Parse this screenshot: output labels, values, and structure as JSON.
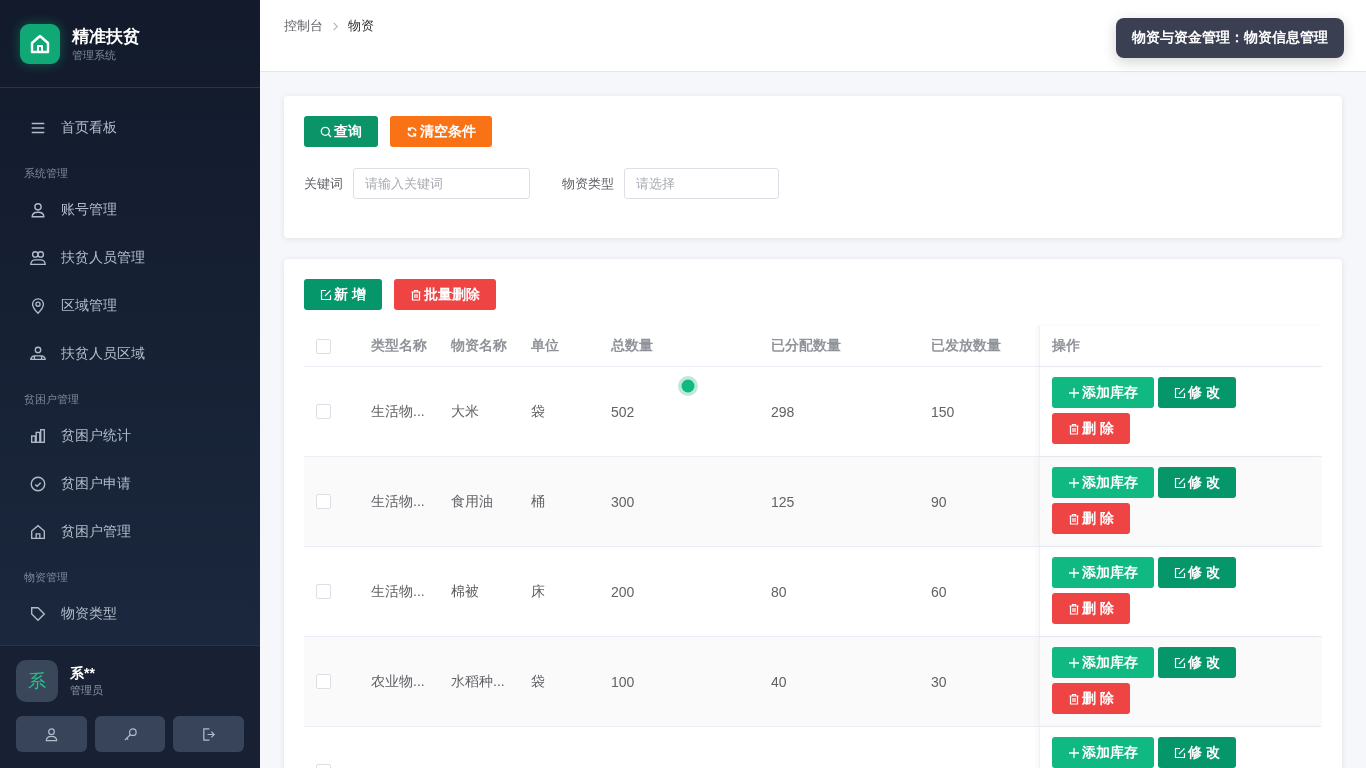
{
  "sidebar": {
    "brand": {
      "title": "精准扶贫",
      "subtitle": "管理系统"
    },
    "groups": [
      {
        "items": [
          {
            "label": "首页看板",
            "selected": false
          }
        ]
      },
      {
        "title": "系统管理",
        "items": [
          {
            "label": "账号管理",
            "selected": false
          },
          {
            "label": "扶贫人员管理",
            "selected": false
          },
          {
            "label": "区域管理",
            "selected": false
          },
          {
            "label": "扶贫人员区域",
            "selected": false
          }
        ]
      },
      {
        "title": "贫困户管理",
        "items": [
          {
            "label": "贫困户统计",
            "selected": false
          },
          {
            "label": "贫困户申请",
            "selected": false
          },
          {
            "label": "贫困户管理",
            "selected": false
          }
        ]
      },
      {
        "title": "物资管理",
        "items": [
          {
            "label": "物资类型",
            "selected": false
          }
        ]
      }
    ],
    "user": {
      "avatar": "系",
      "name": "系**",
      "role": "管理员"
    }
  },
  "breadcrumb": [
    "控制台",
    "物资"
  ],
  "toast": "物资与资金管理：物资信息管理",
  "search": {
    "buttons": [
      "查询",
      "清空条件"
    ],
    "fields": [
      {
        "label": "关键词",
        "placeholder": "请输入关键词"
      },
      {
        "label": "物资类型",
        "placeholder": "请选择"
      }
    ]
  },
  "toolbar": [
    "新 增",
    "批量删除"
  ],
  "table": {
    "columns": [
      "类型名称",
      "物资名称",
      "单位",
      "总数量",
      "已分配数量",
      "已发放数量",
      "操作"
    ],
    "header_checked": false,
    "rows": [
      {
        "checked": false,
        "cells": [
          "生活物...",
          "大米",
          "袋",
          "502",
          "298",
          "150"
        ],
        "actions": [
          "添加库存",
          "修 改",
          "删 除"
        ]
      },
      {
        "checked": false,
        "cells": [
          "生活物...",
          "食用油",
          "桶",
          "300",
          "125",
          "90"
        ],
        "actions": [
          "添加库存",
          "修 改",
          "删 除"
        ]
      },
      {
        "checked": false,
        "cells": [
          "生活物...",
          "棉被",
          "床",
          "200",
          "80",
          "60"
        ],
        "actions": [
          "添加库存",
          "修 改",
          "删 除"
        ]
      },
      {
        "checked": false,
        "cells": [
          "农业物...",
          "水稻种...",
          "袋",
          "100",
          "40",
          "30"
        ],
        "actions": [
          "添加库存",
          "修 改",
          "删 除"
        ]
      },
      {
        "checked": false,
        "actions": [
          "添加库存",
          "修 改"
        ]
      }
    ]
  }
}
